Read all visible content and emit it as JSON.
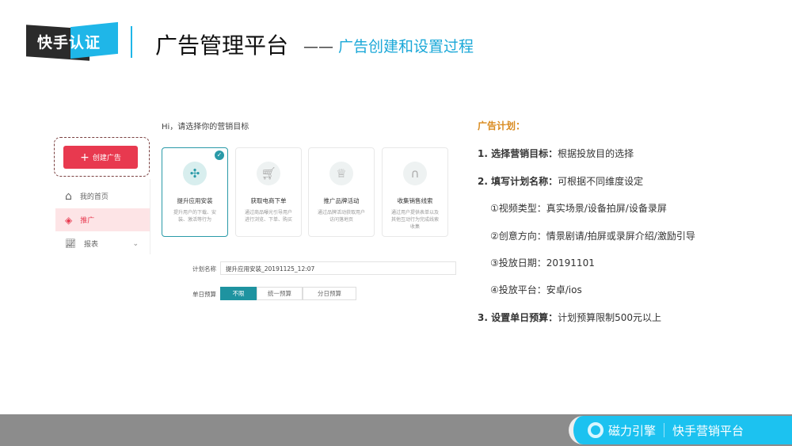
{
  "header": {
    "logo": "快手认证",
    "title": "广告管理平台",
    "dash": "——",
    "subtitle": "广告创建和设置过程"
  },
  "app": {
    "greeting": "Hi，请选择你的营销目标",
    "create_button": "创建广告",
    "nav": [
      {
        "label": "我的首页",
        "icon": "home-icon"
      },
      {
        "label": "推广",
        "icon": "layers-icon"
      },
      {
        "label": "报表",
        "icon": "chart-icon"
      }
    ],
    "cards": [
      {
        "name": "提升应用安装",
        "desc": "提升用户的下载、安装、激活等行为",
        "icon": "apps-icon",
        "selected": true
      },
      {
        "name": "获取电商下单",
        "desc": "通过商品曝光引导用户进行浏览、下单、购买",
        "icon": "cart-icon"
      },
      {
        "name": "推广品牌活动",
        "desc": "通过品牌活动获取用户访问落地页",
        "icon": "crown-icon"
      },
      {
        "name": "收集销售线索",
        "desc": "通过用户提供表单以及其他互动行为完成线索收集",
        "icon": "route-icon"
      }
    ],
    "plan_name_label": "计划名称",
    "plan_name_value": "提升应用安装_20191125_12:07",
    "budget_label": "单日预算",
    "budget_options": [
      "不限",
      "统一预算",
      "分日预算"
    ],
    "budget_selected": "不限"
  },
  "notes": {
    "heading": "广告计划：",
    "items": [
      {
        "k": "1. 选择营销目标：",
        "v": "根据投放目的选择"
      },
      {
        "k": "2. 填写计划名称：",
        "v": "可根据不同维度设定"
      },
      {
        "k": "",
        "v": "①视频类型：真实场景/设备拍屏/设备录屏"
      },
      {
        "k": "",
        "v": "②创意方向：情景剧请/拍屏或录屏介绍/激励引导"
      },
      {
        "k": "",
        "v": "③投放日期：20191101"
      },
      {
        "k": "",
        "v": "④投放平台：安卓/ios"
      },
      {
        "k": "3. 设置单日预算：",
        "v": "计划预算限制500元以上"
      }
    ]
  },
  "footer": {
    "brand1": "磁力引擎",
    "brand2": "快手营销平台"
  }
}
